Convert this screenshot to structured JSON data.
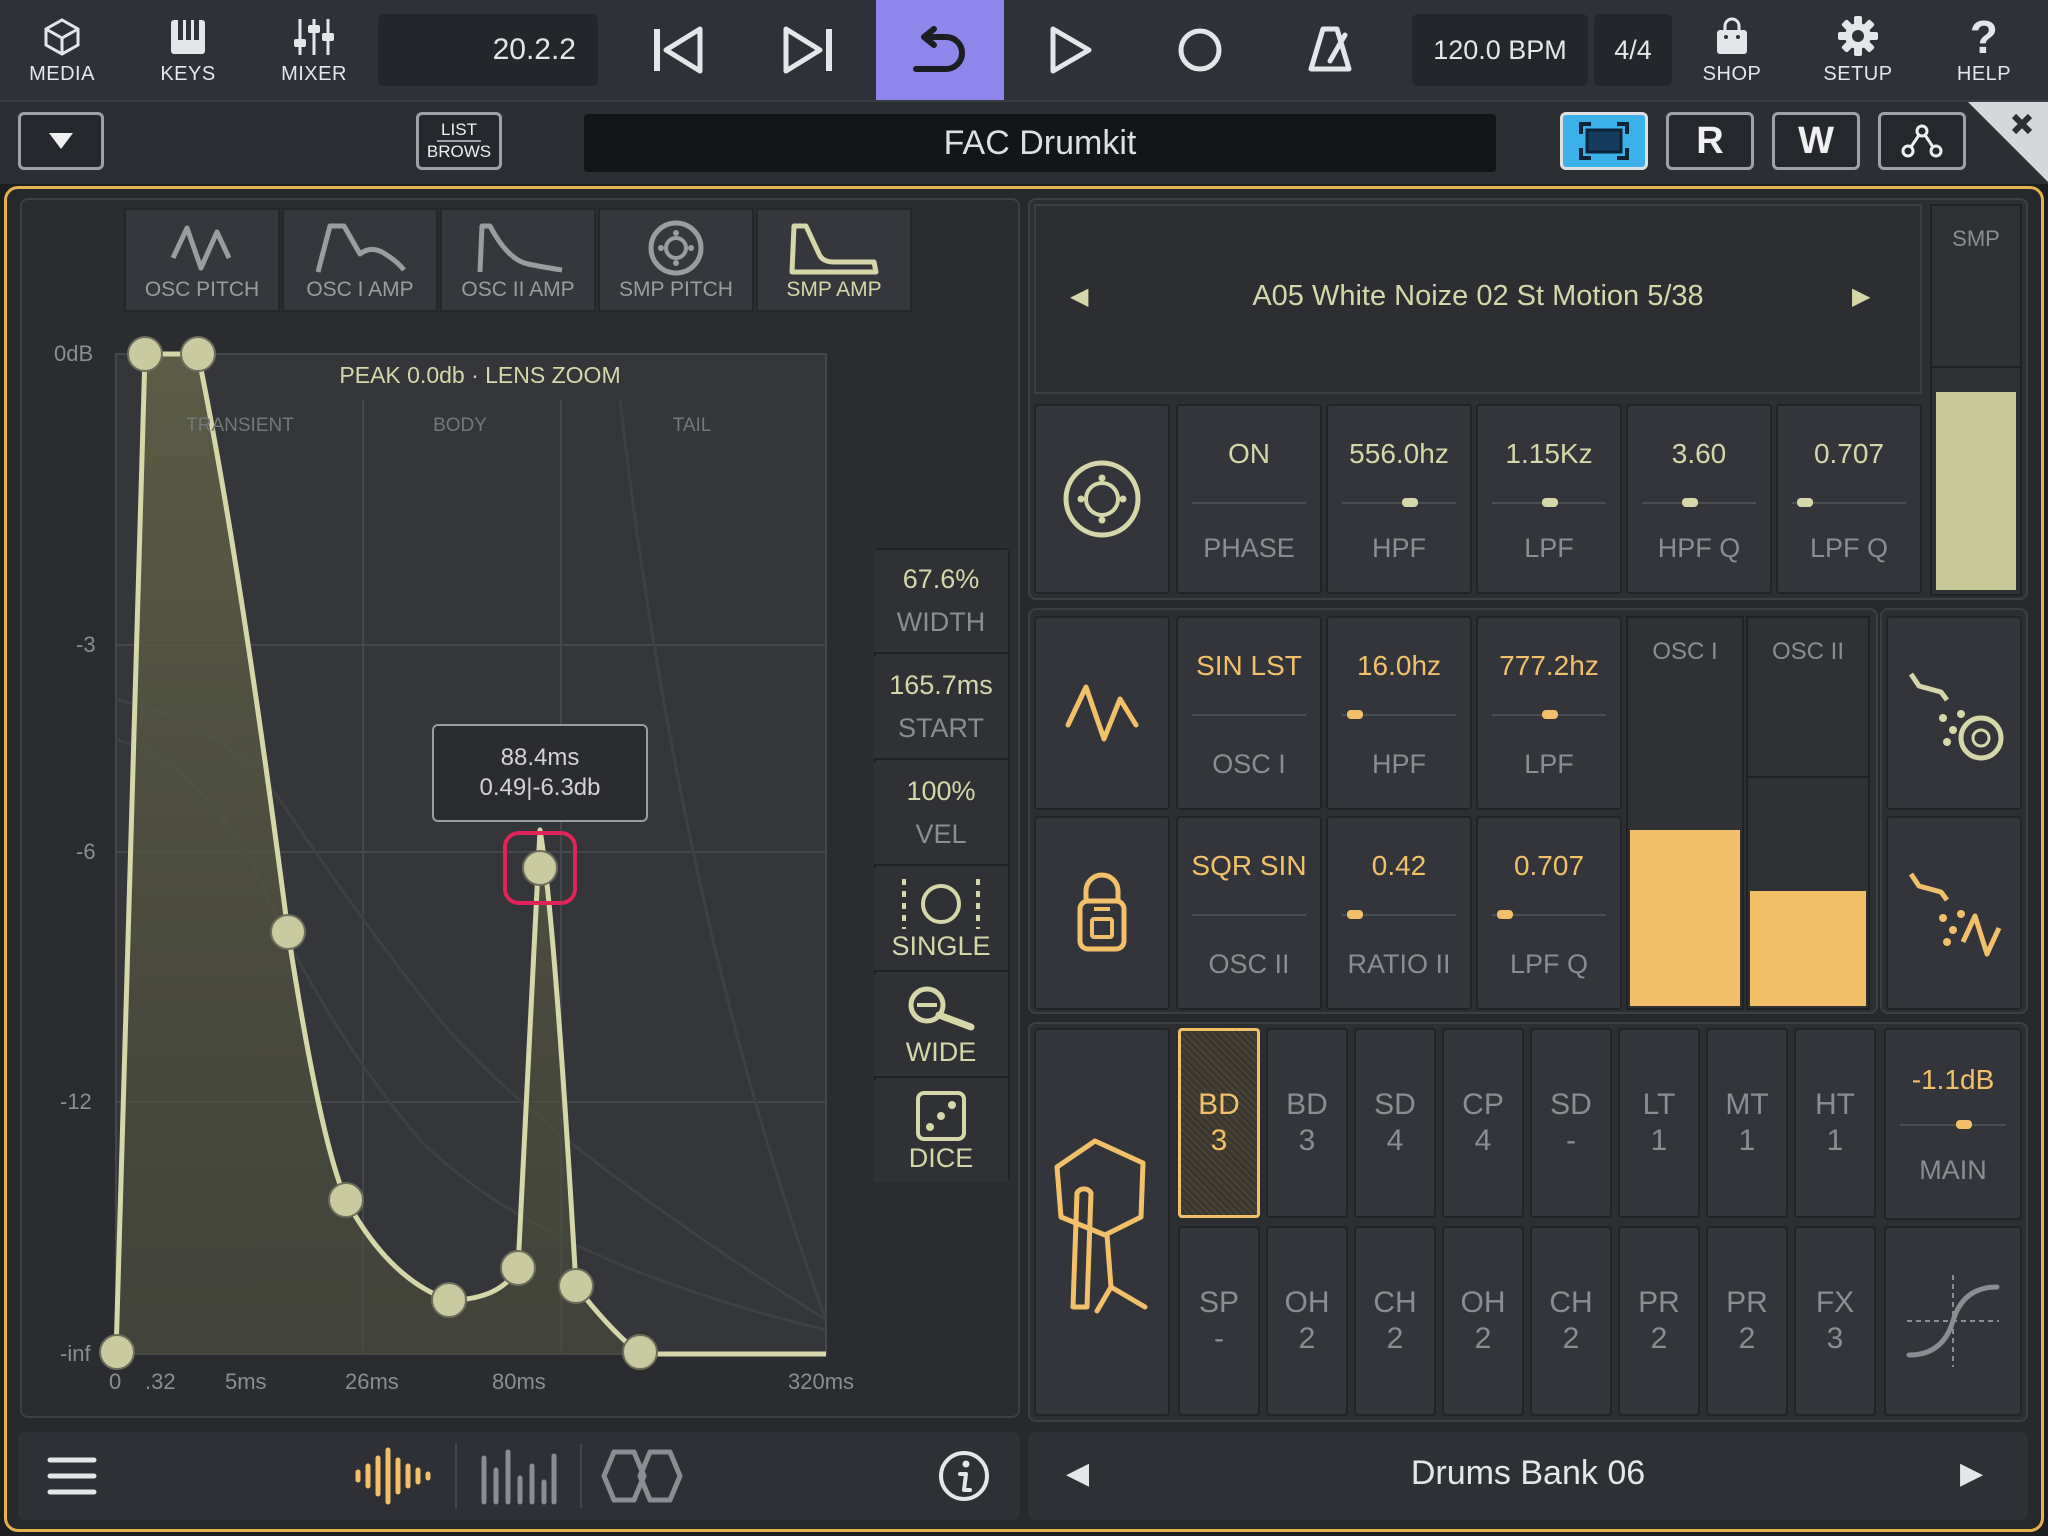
{
  "toolbar": {
    "media": "MEDIA",
    "keys": "KEYS",
    "mixer": "MIXER",
    "position": "20.2.2",
    "tempo": "120.0 BPM",
    "signature": "4/4",
    "shop": "SHOP",
    "setup": "SETUP",
    "help": "HELP",
    "loop_color": "#8f86ec"
  },
  "subbar": {
    "list_line1": "LIST",
    "list_line2": "BROWS",
    "preset": "FAC Drumkit",
    "r_label": "R",
    "w_label": "W"
  },
  "envelope": {
    "tabs": [
      {
        "label": "OSC PITCH",
        "icon": "osc-pitch-icon"
      },
      {
        "label": "OSC I AMP",
        "icon": "osc-amp-icon"
      },
      {
        "label": "OSC II AMP",
        "icon": "osc-amp-icon"
      },
      {
        "label": "SMP PITCH",
        "icon": "smp-pitch-icon"
      },
      {
        "label": "SMP AMP",
        "icon": "smp-amp-icon",
        "active": true
      }
    ],
    "peak": "PEAK 0.0db · LENS ZOOM",
    "sections": [
      "TRANSIENT",
      "BODY",
      "TAIL"
    ],
    "y_labels": [
      "0dB",
      "-3",
      "-6",
      "-12",
      "-inf"
    ],
    "x_labels": [
      "0",
      ".32",
      "5ms",
      "26ms",
      "80ms",
      "320ms"
    ],
    "tooltip_line1": "88.4ms",
    "tooltip_line2": "0.49|-6.3db"
  },
  "lens": {
    "width_value": "67.6%",
    "width_label": "WIDTH",
    "start_value": "165.7ms",
    "start_label": "START",
    "vel_value": "100%",
    "vel_label": "VEL",
    "single_label": "SINGLE",
    "wide_label": "WIDE",
    "dice_label": "DICE"
  },
  "sample": {
    "name": "A05 White Noize 02 St Motion 5/38",
    "level_label": "SMP",
    "level": 0.9,
    "params": [
      {
        "value": "ON",
        "label": "PHASE"
      },
      {
        "value": "556.0hz",
        "label": "HPF",
        "pos": 0.6
      },
      {
        "value": "1.15Kz",
        "label": "LPF",
        "pos": 0.5
      },
      {
        "value": "3.60",
        "label": "HPF Q",
        "pos": 0.4
      },
      {
        "value": "0.707",
        "label": "LPF Q",
        "pos": 0.05
      }
    ]
  },
  "osc": {
    "row1": [
      {
        "value": "SIN LST",
        "label": "OSC I"
      },
      {
        "value": "16.0hz",
        "label": "HPF",
        "pos": 0.05
      },
      {
        "value": "777.2hz",
        "label": "LPF",
        "pos": 0.5
      }
    ],
    "row2": [
      {
        "value": "SQR SIN",
        "label": "OSC II"
      },
      {
        "value": "0.42",
        "label": "RATIO II",
        "pos": 0.05
      },
      {
        "value": "0.707",
        "label": "LPF Q",
        "pos": 0.05
      }
    ],
    "osc1_label": "OSC I",
    "osc2_label": "OSC II",
    "osc1_level": 0.7,
    "osc2_level": 0.5
  },
  "pads": {
    "row1": [
      {
        "top": "BD",
        "bottom": "3",
        "active": true
      },
      {
        "top": "BD",
        "bottom": "3"
      },
      {
        "top": "SD",
        "bottom": "4"
      },
      {
        "top": "CP",
        "bottom": "4"
      },
      {
        "top": "SD",
        "bottom": "-"
      },
      {
        "top": "LT",
        "bottom": "1"
      },
      {
        "top": "MT",
        "bottom": "1"
      },
      {
        "top": "HT",
        "bottom": "1"
      }
    ],
    "row2": [
      {
        "top": "SP",
        "bottom": "-"
      },
      {
        "top": "OH",
        "bottom": "2"
      },
      {
        "top": "CH",
        "bottom": "2"
      },
      {
        "top": "OH",
        "bottom": "2"
      },
      {
        "top": "CH",
        "bottom": "2"
      },
      {
        "top": "PR",
        "bottom": "2"
      },
      {
        "top": "PR",
        "bottom": "2"
      },
      {
        "top": "FX",
        "bottom": "3"
      }
    ],
    "main_value": "-1.1dB",
    "main_label": "MAIN"
  },
  "bank": {
    "name": "Drums Bank 06"
  }
}
